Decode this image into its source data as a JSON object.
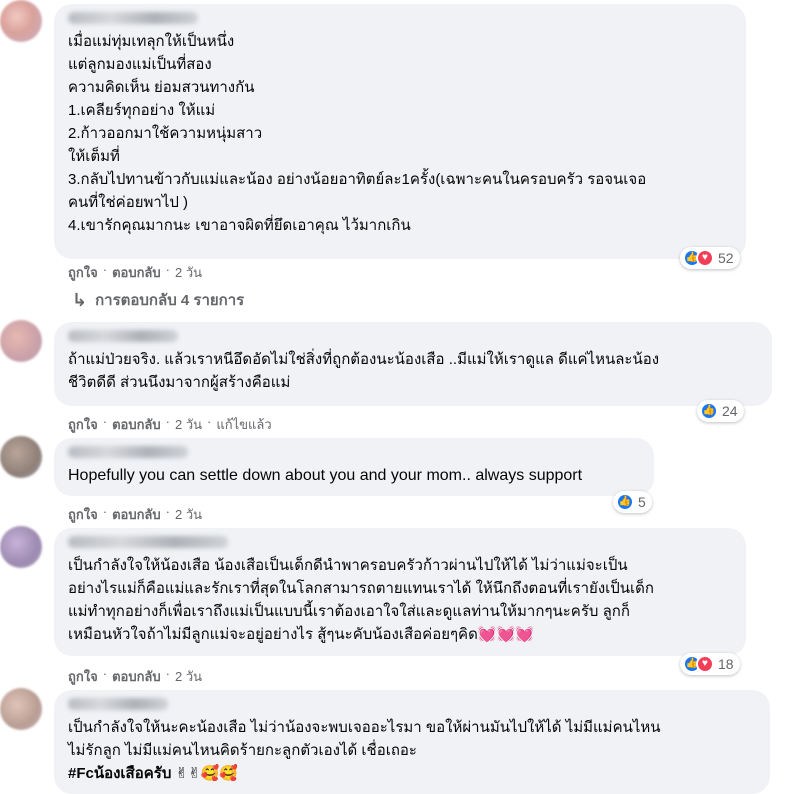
{
  "comments": [
    {
      "text": "เมื่อแม่ทุ่มเทลุกให้เป็นหนึ่ง\nแต่ลูกมองแม่เป็นที่สอง\nความคิดเห็น ย่อมสวนทางกัน\n1.เคลียร์ทุกอย่าง ให้แม่\n2.ก้าวออกมาใช้ความหนุ่มสาว\nให้เต็มที่\n3.กลับไปทานข้าวกับแม่และน้อง อย่างน้อยอาทิตย์ละ1ครั้ง(เฉพาะคนในครอบครัว รอจนเจอ\nคนที่ใช่ค่อยพาไป )\n4.เขารักคุณมากนะ เขาอาจผิดที่ยึดเอาคุณ ไว้มากเกิน",
      "like": "ถูกใจ",
      "reply": "ตอบกลับ",
      "time": "2 วัน",
      "reaction_count": "52",
      "replies_label": "การตอบกลับ 4 รายการ"
    },
    {
      "text": "ถ้าแม่ป่วยจริง. แล้วเราหนีอึดอัดไม่ใช่สิ่งที่ถูกต้องนะน้องเสือ ..มีแม่ให้เราดูแล ดีแค่ไหนละน้อง\nชีวิตดีดี ส่วนนึงมาจากผู้สร้างคือแม่",
      "like": "ถูกใจ",
      "reply": "ตอบกลับ",
      "time": "2 วัน",
      "edited": "แก้ไขแล้ว",
      "reaction_count": "24"
    },
    {
      "text": "Hopefully you can settle down about you and your mom.. always support",
      "like": "ถูกใจ",
      "reply": "ตอบกลับ",
      "time": "2 วัน",
      "reaction_count": "5"
    },
    {
      "text": "เป็นกำลังใจให้น้องเสือ น้องเสือเป็นเด็กดีนำพาครอบครัวก้าวผ่านไปให้ได้ ไม่ว่าแม่จะเป็น\nอย่างไรแม่ก็คือแม่และรักเราที่สุดในโลกสามารถตายแทนเราได้ ให้นึกถึงตอนที่เรายังเป็นเด็ก\nแม่ทำทุกอย่างก็เพื่อเราถึงแม่เป็นแบบนี้เราต้องเอาใจใส่และดูแลท่านให้มากๆนะครับ ลูกก็\nเหมือนหัวใจถ้าไม่มีลูกแม่จะอยู่อย่างไร สู้ๆนะคับน้องเสือค่อยๆคิด",
      "emojis": "💓💓💓",
      "like": "ถูกใจ",
      "reply": "ตอบกลับ",
      "time": "2 วัน",
      "reaction_count": "18"
    },
    {
      "text": "เป็นกำลังใจให้นะคะน้องเสือ ไม่ว่าน้องจะพบเจออะไรมา ขอให้ผ่านมันไปให้ได้ ไม่มีแม่คนไหน\nไม่รักลูก ไม่มีแม่คนไหนคิดร้ายกะลูกตัวเองได้ เชื่อเถอะ",
      "hashtag": "#Fcน้องเสือครับ",
      "emojis": "✌✌🥰🥰"
    }
  ],
  "separator": "·",
  "colors": {
    "bubble": "#f0f2f5",
    "meta": "#65676b",
    "like": "#1877f2",
    "love": "#f33e58"
  },
  "icons": [
    "like-icon",
    "love-icon",
    "reply-arrow-icon"
  ]
}
